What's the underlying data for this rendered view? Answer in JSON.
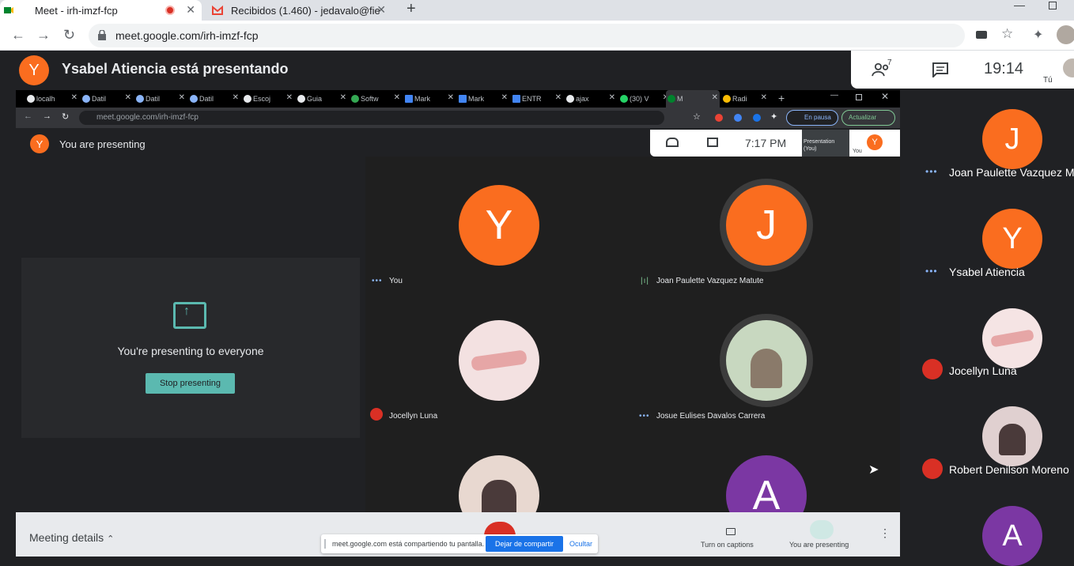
{
  "browser": {
    "tabs": [
      {
        "title": "Meet - irh-imzf-fcp",
        "active": true
      },
      {
        "title": "Recibidos (1.460) - jedavalo@fie",
        "active": false
      }
    ],
    "new_tab": "+",
    "url": "meet.google.com/irh-imzf-fcp"
  },
  "meeting": {
    "presenter_initial": "Y",
    "presenter_title": "Ysabel Atiencia está presentando",
    "participant_count": "7",
    "clock": "19:14",
    "you_label": "Tú"
  },
  "shared_screen": {
    "tabs": [
      "localh",
      "Datil",
      "Datil",
      "Datil",
      "Escoj",
      "Guia",
      "Softw",
      "Mark",
      "Mark",
      "ENTR",
      "ajax",
      "(30) V",
      "M",
      "Radi"
    ],
    "url": "meet.google.com/irh-imzf-fcp",
    "paused_label": "En pausa",
    "update_label": "Actualizar",
    "you_are_presenting": "You are presenting",
    "time": "7:17 PM",
    "presentation_label": "Presentation (You)",
    "you_label": "You",
    "presenting_to_everyone": "You're presenting to everyone",
    "stop_presenting": "Stop presenting",
    "tiles": [
      {
        "name": "You",
        "initial": "Y",
        "color": "#fa6d1f"
      },
      {
        "name": "Joan Paulette Vazquez Matute",
        "initial": "J",
        "color": "#fa6d1f"
      },
      {
        "name": "Jocellyn Luna",
        "initial": "",
        "color": "#f3e1e1"
      },
      {
        "name": "Josue Eulises Davalos Carrera",
        "initial": "",
        "color": "#c8d8c0"
      },
      {
        "name": "",
        "initial": "",
        "color": "#e8d8d0"
      },
      {
        "name": "",
        "initial": "A",
        "color": "#7b37a3"
      }
    ],
    "meeting_details": "Meeting details",
    "share_notice": "meet.google.com está compartiendo tu pantalla.",
    "stop_sharing": "Dejar de compartir",
    "hide": "Ocultar",
    "captions": "Turn on captions",
    "you_are_presenting_btn": "You are presenting"
  },
  "participants": [
    {
      "name": "Joan Paulette Vazquez M",
      "initial": "J",
      "color": "#fa6d1f",
      "status": "speaking"
    },
    {
      "name": "Ysabel Atiencia",
      "initial": "Y",
      "color": "#fa6d1f",
      "status": "speaking"
    },
    {
      "name": "Jocellyn Luna",
      "initial": "",
      "color": "#f5e4e4",
      "status": "muted"
    },
    {
      "name": "Robert Denilson Moreno",
      "initial": "",
      "color": "#e0d0d0",
      "status": "muted"
    },
    {
      "name": "",
      "initial": "A",
      "color": "#7b37a3",
      "status": ""
    }
  ]
}
